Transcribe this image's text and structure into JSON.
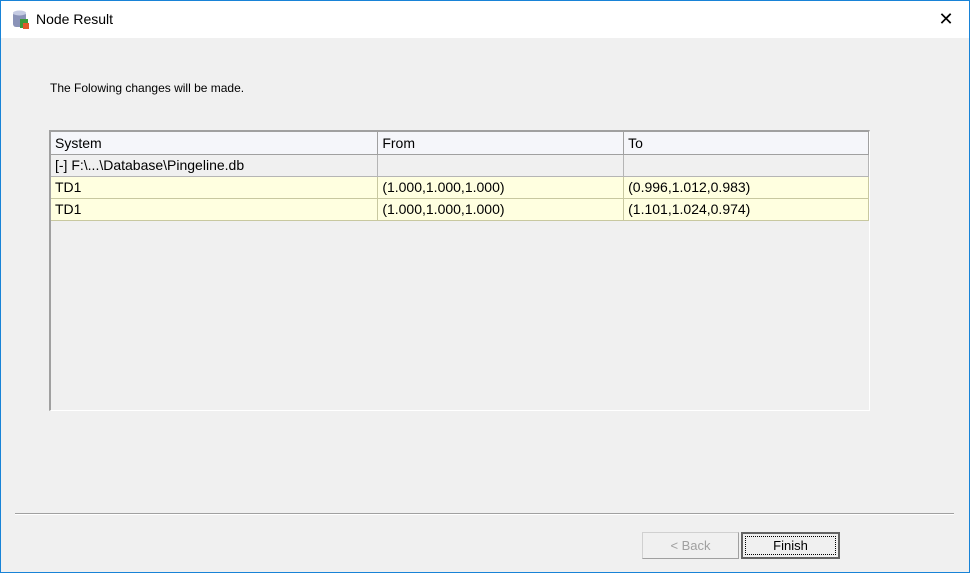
{
  "window": {
    "title": "Node Result",
    "close": "✕"
  },
  "message": "The Folowing changes will be made.",
  "table": {
    "headers": [
      "System",
      "From",
      "To"
    ],
    "group": "[-] F:\\...\\Database\\Pingeline.db",
    "rows": [
      [
        "TD1",
        "(1.000,1.000,1.000)",
        "(0.996,1.012,0.983)"
      ],
      [
        "TD1",
        "(1.000,1.000,1.000)",
        "(1.101,1.024,0.974)"
      ]
    ]
  },
  "buttons": {
    "back": "< Back",
    "finish": "Finish"
  }
}
